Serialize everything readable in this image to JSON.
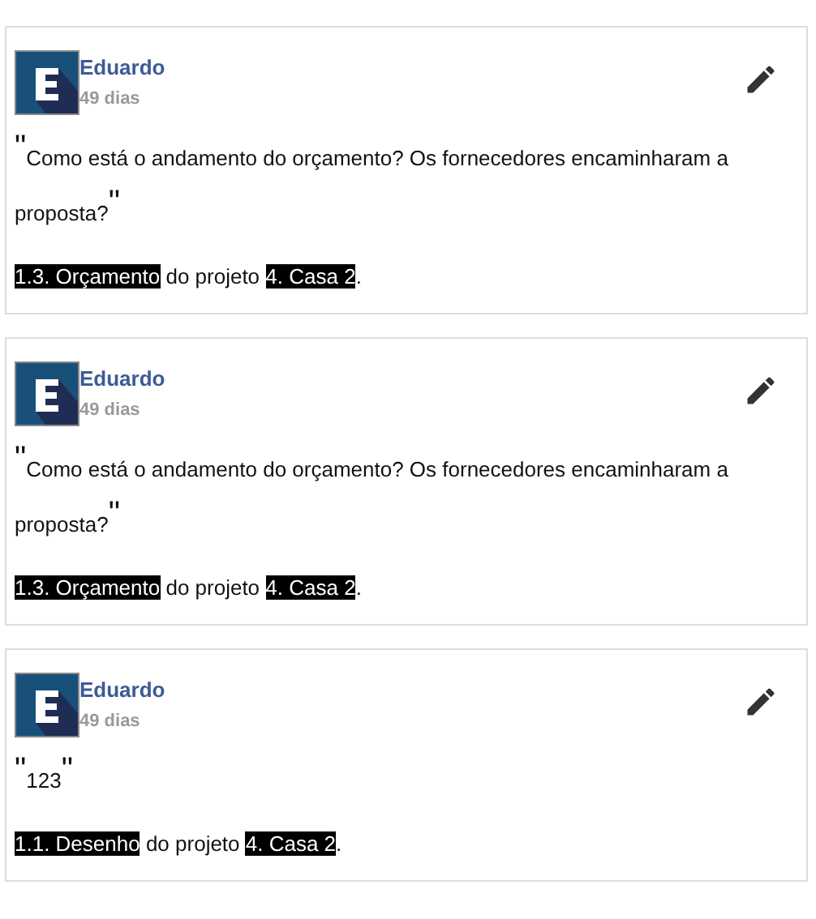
{
  "comments": [
    {
      "author": "Eduardo",
      "time": "49 dias",
      "quote_open": "\"",
      "text": "Como está o andamento do orçamento? Os fornecedores encaminharam a proposta?",
      "quote_close": "\"",
      "reference": [
        {
          "text": "1.3. Orçamento",
          "highlighted": true
        },
        {
          "text": " do projeto ",
          "highlighted": false
        },
        {
          "text": "4. Casa 2",
          "highlighted": true
        },
        {
          "text": ".",
          "highlighted": false
        }
      ]
    },
    {
      "author": "Eduardo",
      "time": "49 dias",
      "quote_open": "\"",
      "text": "Como está o andamento do orçamento? Os fornecedores encaminharam a proposta?",
      "quote_close": "\"",
      "reference": [
        {
          "text": "1.3. Orçamento",
          "highlighted": true
        },
        {
          "text": " do projeto ",
          "highlighted": false
        },
        {
          "text": "4. Casa 2",
          "highlighted": true
        },
        {
          "text": ".",
          "highlighted": false
        }
      ]
    },
    {
      "author": "Eduardo",
      "time": "49 dias",
      "quote_open": "\"",
      "text": "123",
      "quote_close": "\"",
      "reference": [
        {
          "text": "1.1. Desenho",
          "highlighted": true
        },
        {
          "text": " do projeto ",
          "highlighted": false
        },
        {
          "text": "4. Casa 2",
          "highlighted": true
        },
        {
          "text": ".",
          "highlighted": false
        }
      ]
    }
  ]
}
